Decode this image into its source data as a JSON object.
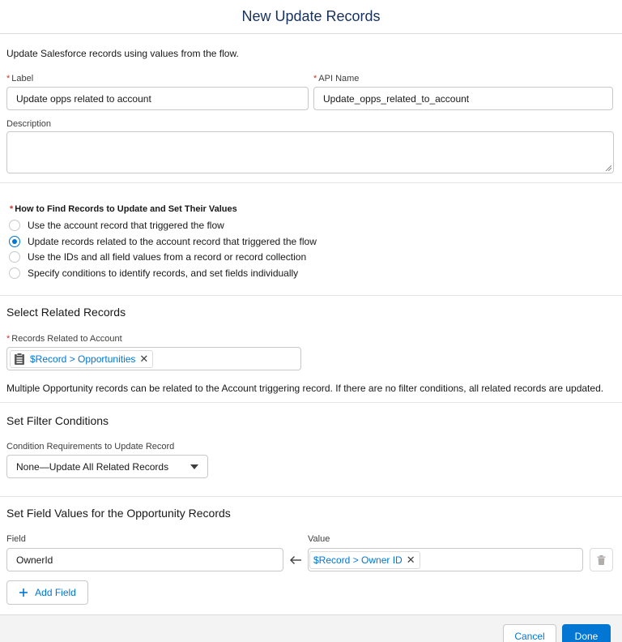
{
  "modal": {
    "title": "New Update Records"
  },
  "intro": "Update Salesforce records using values from the flow.",
  "fields": {
    "label": {
      "label": "Label",
      "value": "Update opps related to account"
    },
    "api_name": {
      "label": "API Name",
      "value": "Update_opps_related_to_account"
    },
    "description": {
      "label": "Description",
      "value": ""
    }
  },
  "find_records": {
    "title": "How to Find Records to Update and Set Their Values",
    "options": [
      {
        "label": "Use the account record that triggered the flow",
        "selected": false
      },
      {
        "label": "Update records related to the account record that triggered the flow",
        "selected": true
      },
      {
        "label": "Use the IDs and all field values from a record or record collection",
        "selected": false
      },
      {
        "label": "Specify conditions to identify records, and set fields individually",
        "selected": false
      }
    ]
  },
  "related": {
    "heading": "Select Related Records",
    "field_label": "Records Related to Account",
    "pill": "$Record > Opportunities",
    "help": "Multiple Opportunity records can be related to the Account triggering record. If there are no filter conditions, all related records are updated."
  },
  "filter": {
    "heading": "Set Filter Conditions",
    "field_label": "Condition Requirements to Update Record",
    "selected": "None—Update All Related Records"
  },
  "field_values": {
    "heading": "Set Field Values for the Opportunity Records",
    "field_col": "Field",
    "value_col": "Value",
    "row": {
      "field": "OwnerId",
      "value_pill": "$Record > Owner ID"
    },
    "add_label": "Add Field"
  },
  "footer": {
    "cancel": "Cancel",
    "done": "Done"
  },
  "icons": {
    "record_list": "record-list-icon",
    "remove": "close-icon",
    "arrow": "left-arrow-icon",
    "delete": "trash-icon",
    "add": "plus-icon",
    "dropdown": "chevron-down-icon"
  },
  "colors": {
    "brand": "#0176d3",
    "required": "#c23934",
    "title": "#16325c"
  }
}
